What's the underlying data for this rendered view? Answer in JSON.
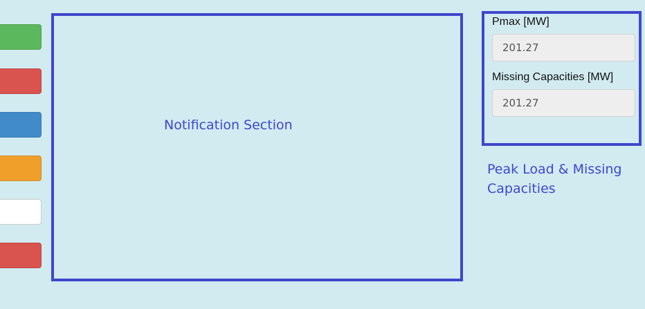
{
  "sidebar": {
    "buttons": [
      {
        "name": "green-button",
        "color": "#5cb85c"
      },
      {
        "name": "red-button",
        "color": "#d9534f"
      },
      {
        "name": "blue-button",
        "color": "#428bca"
      },
      {
        "name": "orange-button",
        "color": "#f0a02a"
      },
      {
        "name": "white-button",
        "color": "#ffffff"
      },
      {
        "name": "red-button-2",
        "color": "#d9534f"
      }
    ]
  },
  "annotations": {
    "notification": "Notification Section",
    "peak": "Peak Load & Missing Capacities"
  },
  "panel": {
    "pmax_label": "Pmax [MW]",
    "pmax_value": "201.27",
    "missing_label": "Missing Capacities [MW]",
    "missing_value": "201.27"
  },
  "colors": {
    "background": "#d2ebf1",
    "annotation": "#3f47cc"
  }
}
